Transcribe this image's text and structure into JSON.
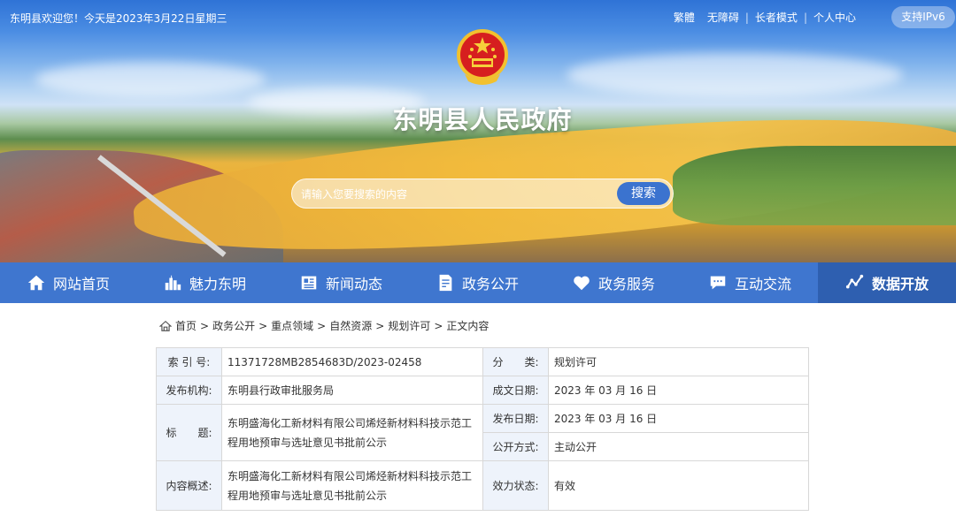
{
  "header": {
    "welcome": "东明县欢迎您！今天是2023年3月22日星期三",
    "links": [
      "繁體",
      "无障碍",
      "长者模式",
      "个人中心"
    ],
    "ipv6_label": "支持IPv6",
    "site_title": "东明县人民政府",
    "search": {
      "placeholder": "请输入您要搜索的内容",
      "button_label": "搜索"
    }
  },
  "nav": {
    "items": [
      {
        "label": "网站首页",
        "icon": "home-icon"
      },
      {
        "label": "魅力东明",
        "icon": "city-icon"
      },
      {
        "label": "新闻动态",
        "icon": "news-icon"
      },
      {
        "label": "政务公开",
        "icon": "document-icon"
      },
      {
        "label": "政务服务",
        "icon": "heart-icon"
      },
      {
        "label": "互动交流",
        "icon": "chat-icon"
      },
      {
        "label": "数据开放",
        "icon": "data-icon"
      }
    ],
    "active_index": 6,
    "color": "#3f76cf",
    "active_color": "#2e5fb0"
  },
  "breadcrumb": {
    "items": [
      "首页",
      "政务公开",
      "重点领域",
      "自然资源",
      "规划许可",
      "正文内容"
    ],
    "separator": ">"
  },
  "info": {
    "index_label": "索 引 号:",
    "index_value": "11371728MB2854683D/2023-02458",
    "category_label": "分　　类:",
    "category_value": "规划许可",
    "publisher_label": "发布机构:",
    "publisher_value": "东明县行政审批服务局",
    "created_label": "成文日期:",
    "created_value": "2023 年 03 月 16 日",
    "title_label": "标　　题:",
    "title_value": "东明盛海化工新材料有限公司烯烃新材料科技示范工程用地预审与选址意见书批前公示",
    "published_label": "发布日期:",
    "published_value": "2023 年 03 月 16 日",
    "open_mode_label": "公开方式:",
    "open_mode_value": "主动公开",
    "summary_label": "内容概述:",
    "summary_value": "东明盛海化工新材料有限公司烯烃新材料科技示范工程用地预审与选址意见书批前公示",
    "status_label": "效力状态:",
    "status_value": "有效"
  }
}
